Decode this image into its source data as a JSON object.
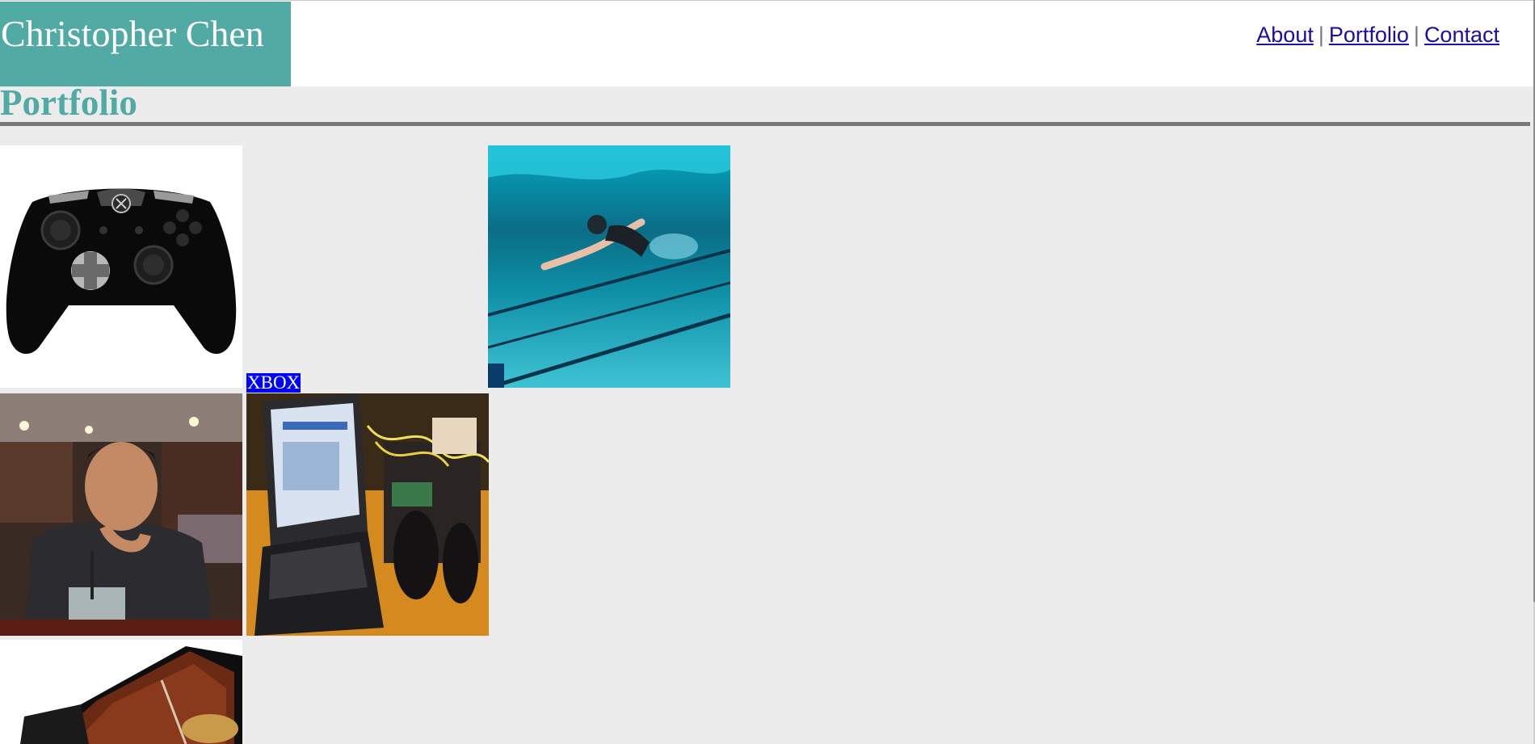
{
  "site": {
    "name": "Christopher Chen"
  },
  "nav": {
    "items": [
      {
        "label": "About"
      },
      {
        "label": "Portfolio"
      },
      {
        "label": "Contact"
      }
    ],
    "separator": "|"
  },
  "section": {
    "title": "Portfolio"
  },
  "portfolio": {
    "items": [
      {
        "image": "xbox-controller",
        "label": "XBOX"
      },
      {
        "image": "swimmer-underwater"
      },
      {
        "image": "person-at-restaurant"
      },
      {
        "image": "laptop-robot-project"
      },
      {
        "image": "grand-piano"
      }
    ]
  },
  "colors": {
    "accent": "#52aaa5",
    "background": "#ececec",
    "link": "#1a0dab",
    "label_bg": "#0000ff",
    "rule": "#7a7a7a"
  }
}
